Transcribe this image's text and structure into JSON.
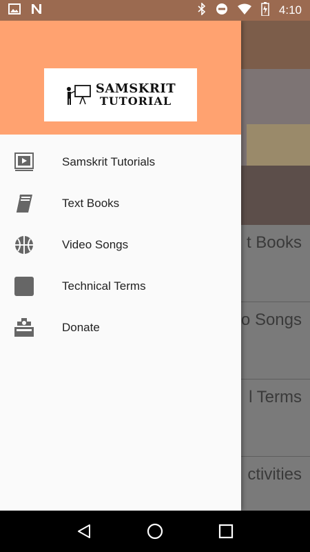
{
  "status_bar": {
    "time": "4:10",
    "left_icons": [
      "image-icon",
      "n-notification-icon"
    ],
    "right_icons": [
      "bluetooth-icon",
      "do-not-disturb-icon",
      "wifi-icon",
      "battery-icon"
    ]
  },
  "drawer": {
    "header_color": "#ffa270",
    "logo": {
      "line1": "SAMSKRIT",
      "line2": "TUTORIAL"
    },
    "items": [
      {
        "label": "Samskrit Tutorials",
        "icon": "video-player-icon"
      },
      {
        "label": "Text Books",
        "icon": "book-icon"
      },
      {
        "label": "Video Songs",
        "icon": "basketball-icon"
      },
      {
        "label": "Technical Terms",
        "icon": "square-icon"
      },
      {
        "label": "Donate",
        "icon": "donate-box-icon"
      }
    ]
  },
  "background": {
    "rows": [
      "t Books",
      "o Songs",
      "l Terms",
      "ctivities"
    ]
  },
  "nav_bar": {
    "buttons": [
      "back-icon",
      "home-icon",
      "recents-icon"
    ]
  }
}
